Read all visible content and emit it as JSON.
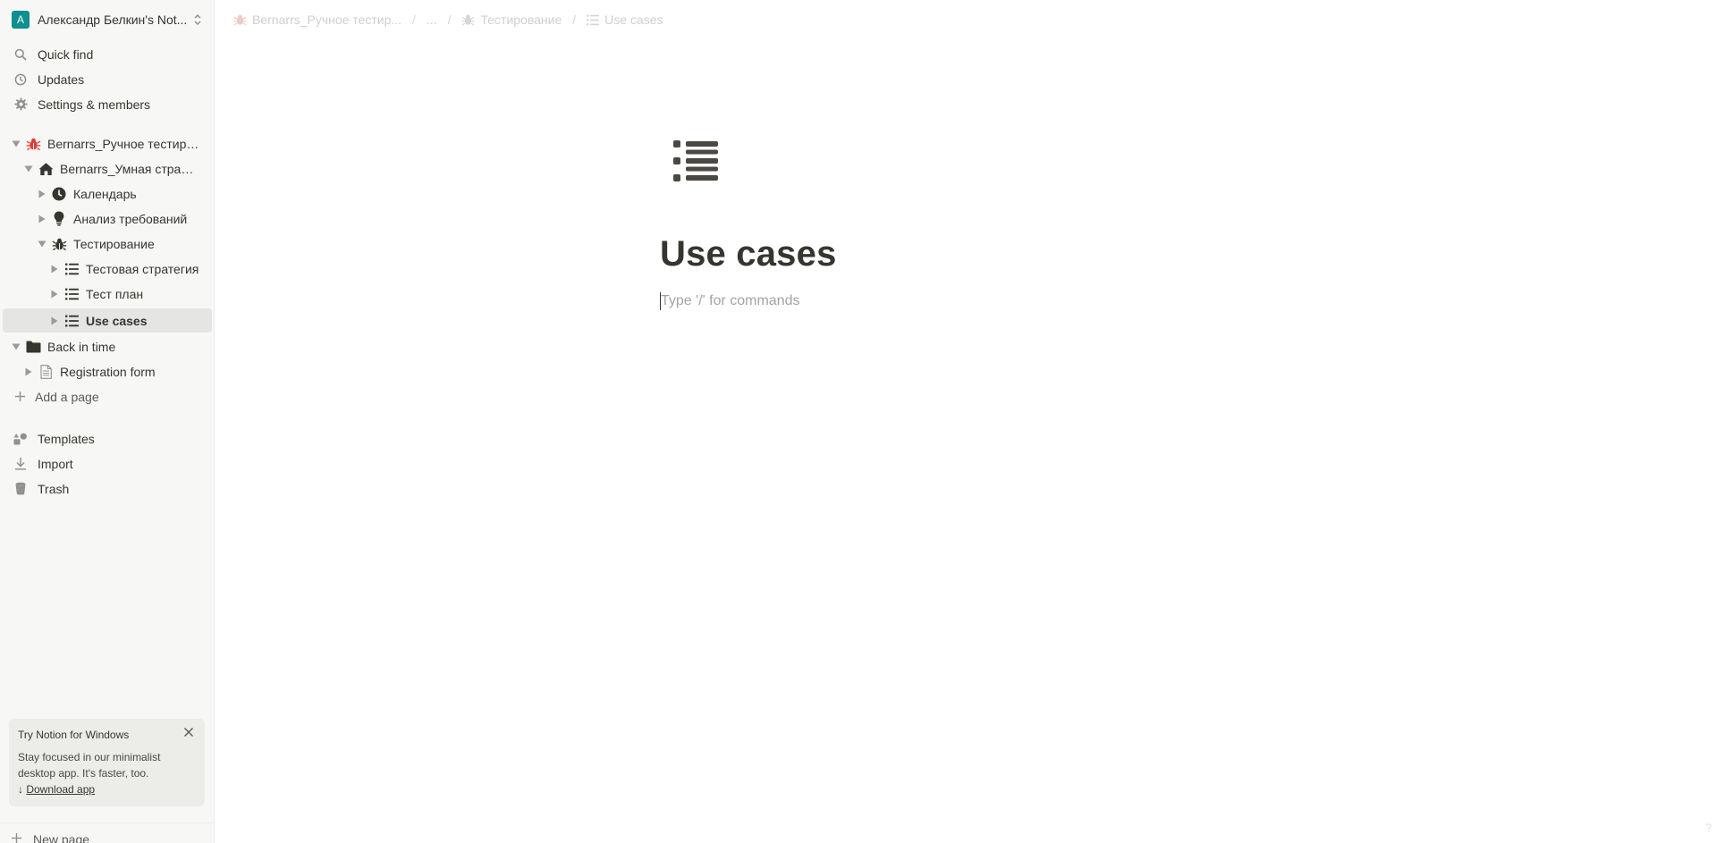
{
  "workspace": {
    "avatar": "A",
    "name": "Александр Белкин's Not...",
    "switch_icon": "chevron-up-down-icon"
  },
  "nav": {
    "quick_find": "Quick find",
    "updates": "Updates",
    "settings": "Settings & members"
  },
  "tree": {
    "root": "Bernarrs_Ручное тестиро...",
    "smart": "Bernarrs_Умная страхо...",
    "calendar": "Календарь",
    "analysis": "Анализ требований",
    "testing": "Тестирование",
    "strategy": "Тестовая стратегия",
    "plan": "Тест план",
    "usecases": "Use cases",
    "back": "Back in time",
    "regform": "Registration form",
    "add_page": "Add a page"
  },
  "bottom_nav": {
    "templates": "Templates",
    "import": "Import",
    "trash": "Trash"
  },
  "promo": {
    "title": "Try Notion for Windows",
    "text": "Stay focused in our minimalist desktop app. It's faster, too.",
    "arrow": "↓",
    "link": "Download app"
  },
  "new_page": "New page",
  "breadcrumb": {
    "item1": "Bernarrs_Ручное тестир...",
    "ellipsis": "...",
    "item2": "Тестирование",
    "item3": "Use cases",
    "separator": "/"
  },
  "page": {
    "title": "Use cases",
    "placeholder": "Type '/' for commands",
    "icon": "bulleted-list-icon"
  },
  "help": "?",
  "colors": {
    "sidebar_bg": "#f7f7f5",
    "active_row": "#e5e5e3",
    "text": "#37352f",
    "bug_red": "#e03e3e",
    "avatar_teal": "#0f8f8f"
  }
}
